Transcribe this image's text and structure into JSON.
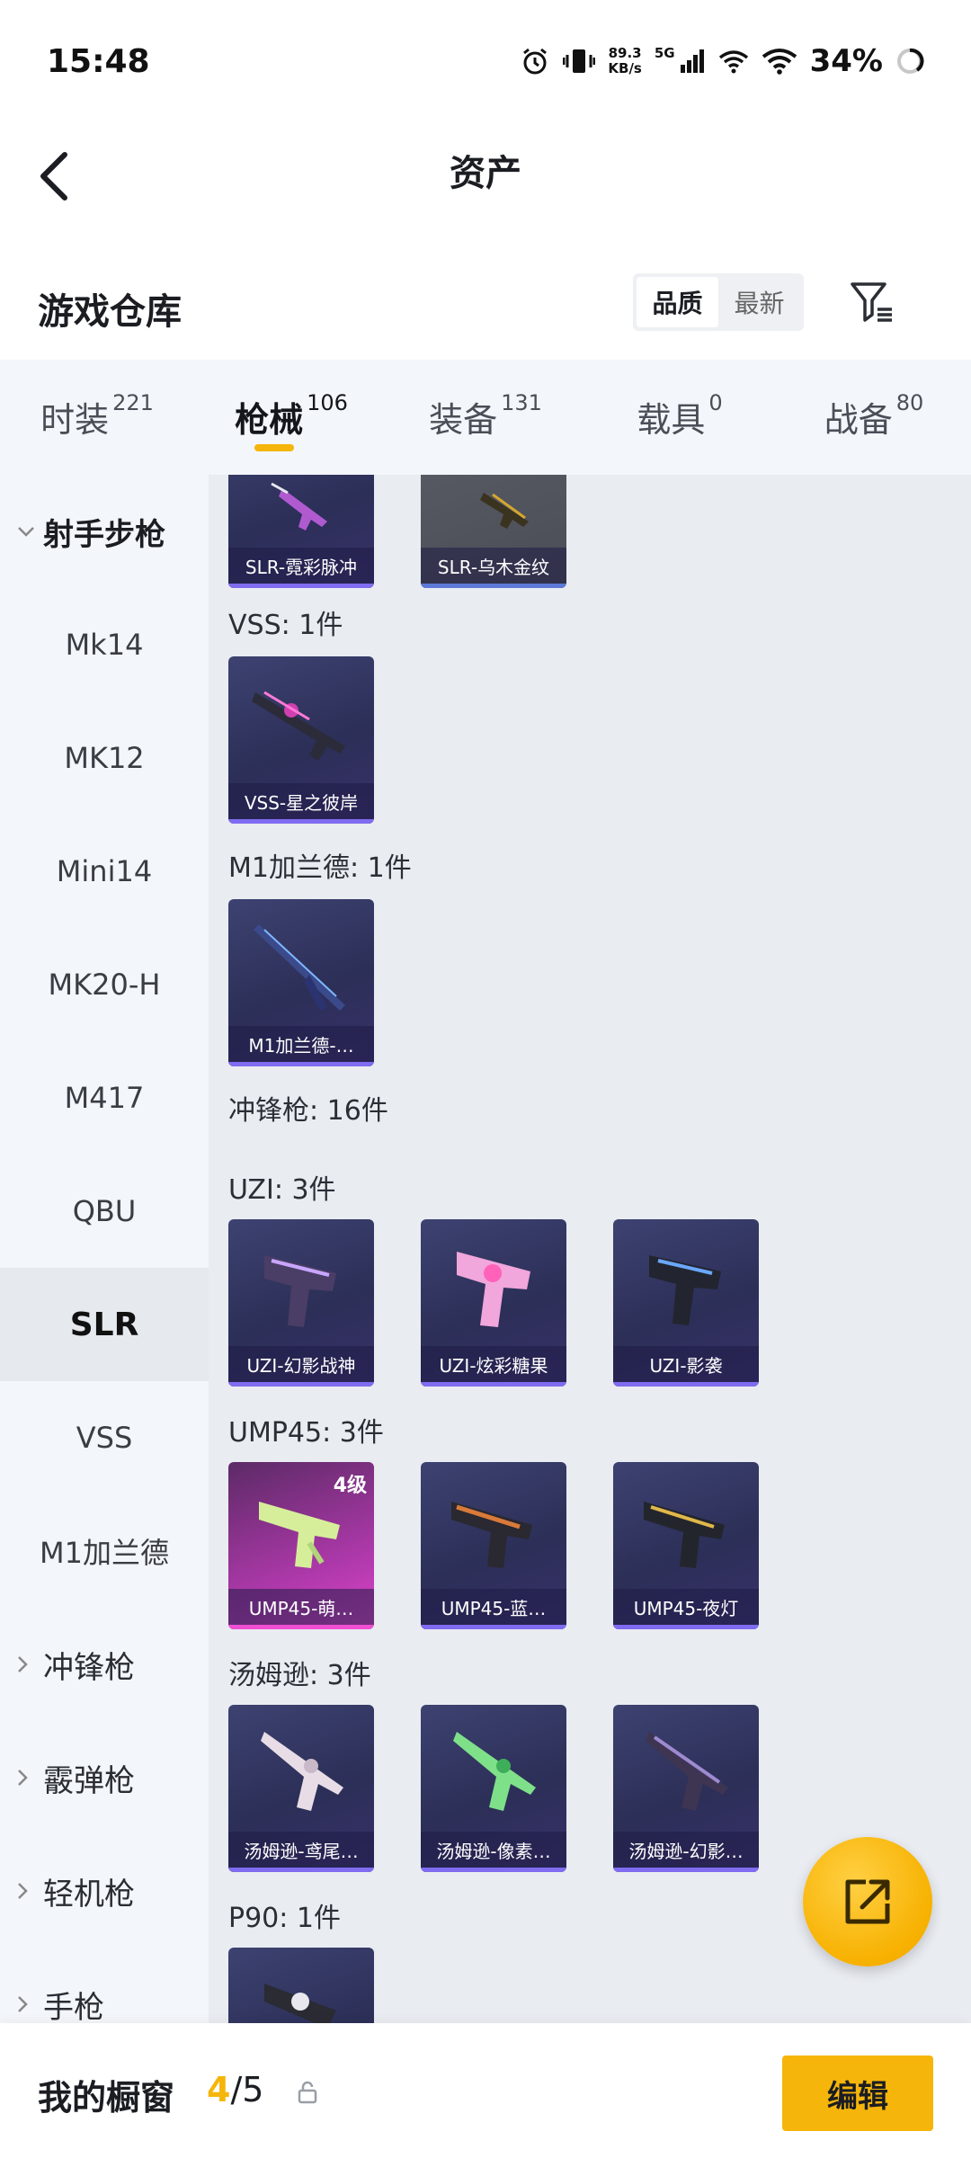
{
  "status_bar": {
    "time": "15:48",
    "net_speed_value": "89.3",
    "net_speed_unit": "KB/s",
    "network": "5G",
    "battery": "34%"
  },
  "header": {
    "title": "资产"
  },
  "warehouse": {
    "title": "游戏仓库",
    "sort_options": [
      "品质",
      "最新"
    ],
    "sort_active": "品质"
  },
  "tabs": [
    {
      "label": "时装",
      "count": "221"
    },
    {
      "label": "枪械",
      "count": "106"
    },
    {
      "label": "装备",
      "count": "131"
    },
    {
      "label": "载具",
      "count": "0"
    },
    {
      "label": "战备",
      "count": "80"
    }
  ],
  "sidebar": {
    "group_open": "射手步枪",
    "items": [
      "Mk14",
      "MK12",
      "Mini14",
      "MK20-H",
      "M417",
      "QBU",
      "SLR",
      "VSS",
      "M1加兰德"
    ],
    "selected": "SLR",
    "collapsed_groups": [
      "冲锋枪",
      "霰弹枪",
      "轻机枪",
      "手枪"
    ]
  },
  "content": {
    "slr_cards": [
      "SLR-霓彩脉冲",
      "SLR-乌木金纹"
    ],
    "vss_label": "VSS: 1件",
    "vss_cards": [
      "VSS-星之彼岸"
    ],
    "m1_label": "M1加兰德: 1件",
    "m1_cards": [
      "M1加兰德-…"
    ],
    "smg_label": "冲锋枪: 16件",
    "uzi_label": "UZI: 3件",
    "uzi_cards": [
      "UZI-幻影战神",
      "UZI-炫彩糖果",
      "UZI-影袭"
    ],
    "ump_label": "UMP45: 3件",
    "ump_cards": [
      "UMP45-萌…",
      "UMP45-蓝…",
      "UMP45-夜灯"
    ],
    "ump_level": "4级",
    "tommy_label": "汤姆逊: 3件",
    "tommy_cards": [
      "汤姆逊-鸢尾…",
      "汤姆逊-像素…",
      "汤姆逊-幻影…"
    ],
    "p90_label": "P90: 1件"
  },
  "bottom_bar": {
    "title": "我的橱窗",
    "current": "4",
    "total": "/5",
    "edit_label": "编辑"
  },
  "colors": {
    "accent": "#f5b50a",
    "card_bg": "#2c2f57",
    "content_bg": "#e9ecf1",
    "sidebar_bg": "#f3f6fa"
  }
}
